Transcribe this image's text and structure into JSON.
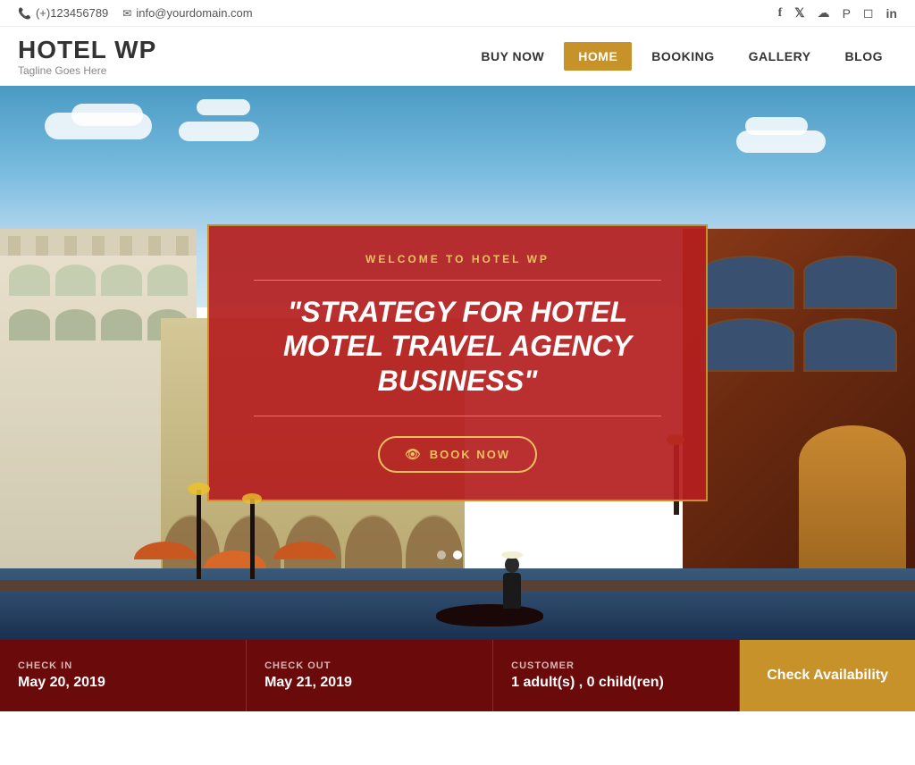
{
  "topbar": {
    "phone": "(+)123456789",
    "email": "info@yourdomain.com",
    "phone_icon": "📞",
    "email_icon": "✉",
    "socials": [
      {
        "name": "facebook",
        "icon": "f",
        "label": "Facebook"
      },
      {
        "name": "twitter",
        "icon": "t",
        "label": "Twitter"
      },
      {
        "name": "skype",
        "icon": "s",
        "label": "Skype"
      },
      {
        "name": "pinterest",
        "icon": "p",
        "label": "Pinterest"
      },
      {
        "name": "instagram",
        "icon": "ig",
        "label": "Instagram"
      },
      {
        "name": "linkedin",
        "icon": "in",
        "label": "LinkedIn"
      }
    ]
  },
  "header": {
    "logo_title": "HOTEL WP",
    "logo_tagline": "Tagline Goes Here"
  },
  "nav": {
    "items": [
      {
        "label": "BUY NOW",
        "active": false
      },
      {
        "label": "HOME",
        "active": true
      },
      {
        "label": "BOOKING",
        "active": false
      },
      {
        "label": "GALLERY",
        "active": false
      },
      {
        "label": "BLOG",
        "active": false
      }
    ]
  },
  "hero": {
    "subtitle": "WELCOME TO HOTEL WP",
    "title": "\"STRATEGY FOR HOTEL MOTEL TRAVEL AGENCY BUSINESS\"",
    "book_now_label": "BOOK NOW",
    "dots": [
      {
        "active": false
      },
      {
        "active": true
      },
      {
        "active": false
      }
    ]
  },
  "booking": {
    "checkin_label": "CHECK IN",
    "checkin_value": "May 20, 2019",
    "checkout_label": "CHECK OUT",
    "checkout_value": "May 21, 2019",
    "customer_label": "CUSTOMER",
    "customer_value": "1 adult(s) , 0 child(ren)",
    "cta_label": "Check Availability"
  },
  "colors": {
    "accent": "#c8922a",
    "hero_bg": "#b41e1e",
    "booking_bar": "#6b0a0a",
    "cta_btn": "#c8922a",
    "nav_active": "#c8922a"
  }
}
